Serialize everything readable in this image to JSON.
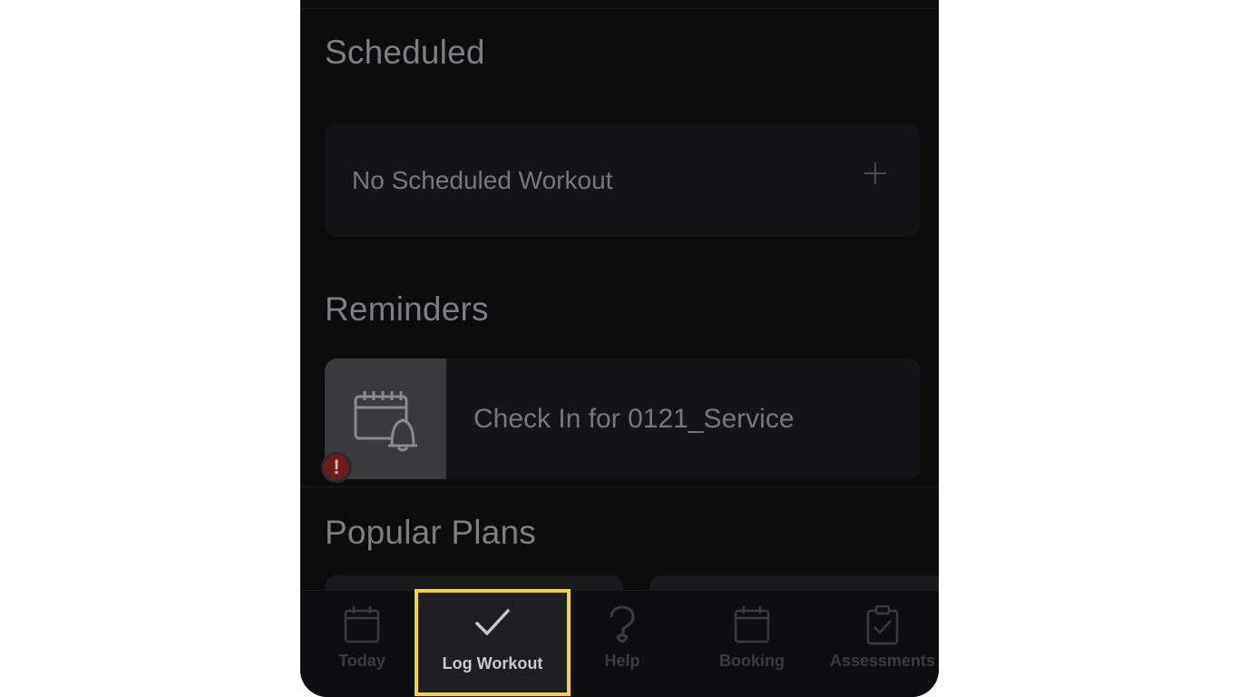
{
  "sections": {
    "scheduled": {
      "title": "Scheduled",
      "empty_label": "No Scheduled Workout"
    },
    "reminders": {
      "title": "Reminders",
      "items": [
        {
          "label": "Check In for 0121_Service",
          "badge": "!"
        }
      ]
    },
    "popular_plans": {
      "title": "Popular Plans"
    }
  },
  "tabbar": {
    "items": [
      {
        "label": "Today",
        "icon": "calendar-icon"
      },
      {
        "label": "Log Workout",
        "icon": "checkmark-icon",
        "highlighted": true
      },
      {
        "label": "Help",
        "icon": "question-mark-icon"
      },
      {
        "label": "Booking",
        "icon": "calendar-icon"
      },
      {
        "label": "Assessments",
        "icon": "clipboard-check-icon"
      }
    ]
  },
  "colors": {
    "background": "#0c0c0d",
    "card": "#141416",
    "highlight_border": "#f5d23a",
    "muted_text": "#7e7e82",
    "alert": "#6e1a1e"
  }
}
